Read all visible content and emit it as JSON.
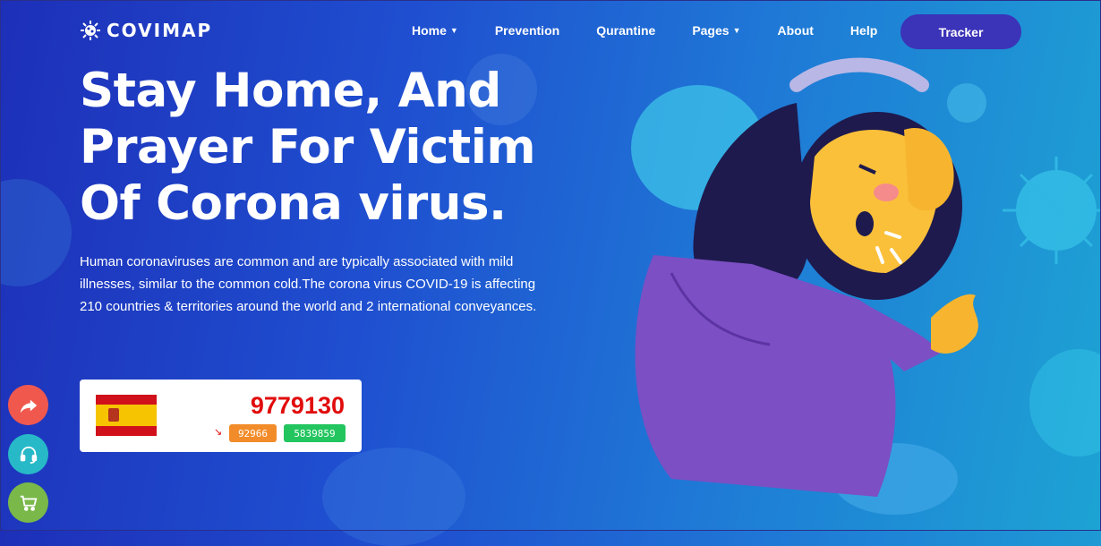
{
  "brand": {
    "name": "COVIMAP"
  },
  "nav": {
    "items": [
      {
        "label": "Home",
        "dropdown": true
      },
      {
        "label": "Prevention",
        "dropdown": false
      },
      {
        "label": "Qurantine",
        "dropdown": false
      },
      {
        "label": "Pages",
        "dropdown": true
      },
      {
        "label": "About",
        "dropdown": false
      },
      {
        "label": "Help",
        "dropdown": false
      }
    ],
    "cta_label": "Tracker"
  },
  "hero": {
    "title": "Stay Home, And Prayer For Victim Of Corona virus.",
    "description": "Human coronaviruses are common and are typically associated with mild illnesses, similar to the common cold.The corona virus COVID-19 is affecting 210 countries & territories around the world and 2 international conveyances."
  },
  "stats": {
    "country_flag": "spain-flag",
    "total": "9779130",
    "trend_icon": "trend-down-icon",
    "badge_orange": "92966",
    "badge_green": "5839859"
  },
  "floating": {
    "share_icon": "share-icon",
    "support_icon": "headset-icon",
    "cart_icon": "cart-icon"
  },
  "colors": {
    "cta_bg": "#3b33b8",
    "total_red": "#e10c0c",
    "badge_orange": "#f28c2a",
    "badge_green": "#22c55e",
    "share_bg": "#f0584e",
    "support_bg": "#27b9c8",
    "cart_bg": "#7ab84a"
  }
}
